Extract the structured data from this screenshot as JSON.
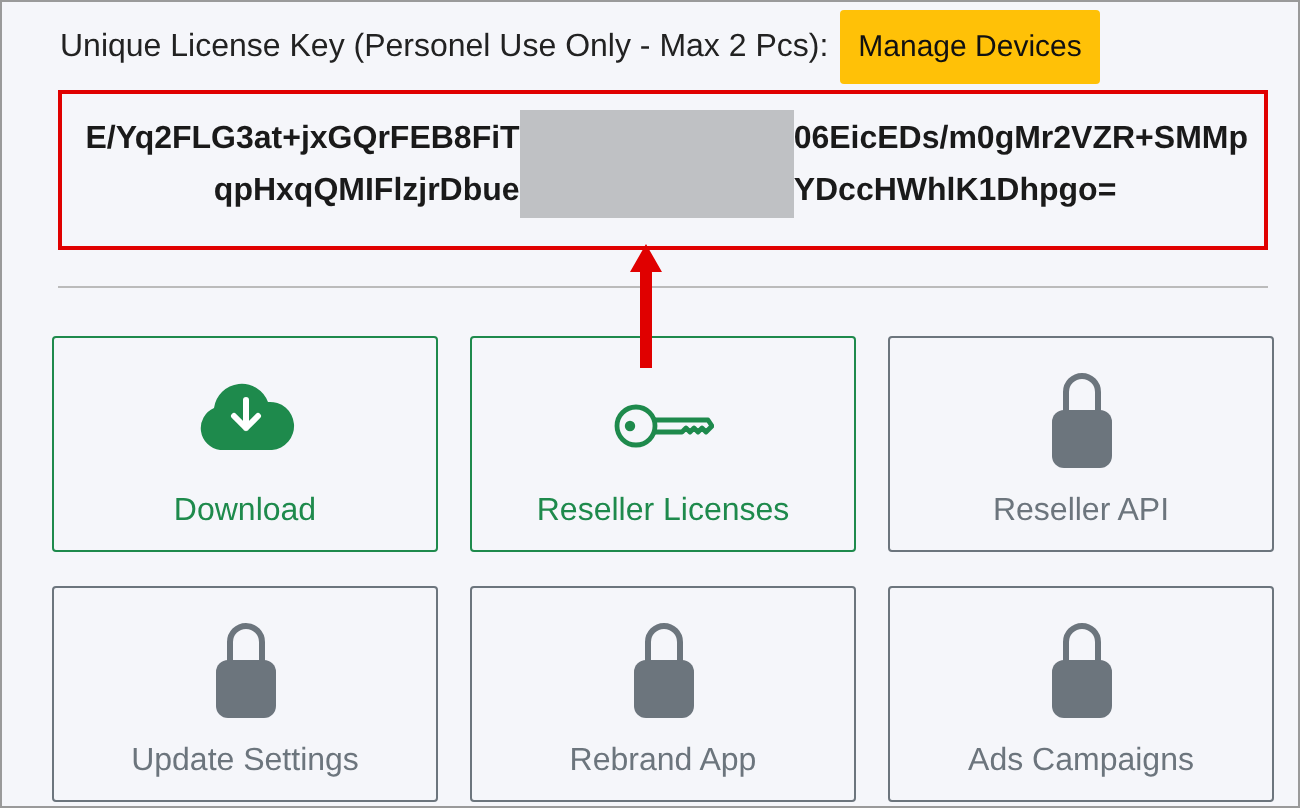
{
  "header": {
    "label": "Unique License Key (Personel Use Only - Max 2 Pcs):",
    "button": "Manage Devices"
  },
  "license_key": {
    "redacted": true,
    "lines": [
      {
        "before": "E/Yq2FLG3at+jxGQrFEB8FiT",
        "after": "06EicEDs/m0gMr2VZR+SMMp"
      },
      {
        "before": "qpHxqQMIFlzjrDbue",
        "after": "YDccHWhlK1Dhpgo="
      }
    ]
  },
  "tiles": [
    {
      "label": "Download",
      "kind": "download",
      "locked": false
    },
    {
      "label": "Reseller Licenses",
      "kind": "key",
      "locked": false
    },
    {
      "label": "Reseller API",
      "kind": "lock",
      "locked": true
    },
    {
      "label": "Update Settings",
      "kind": "lock",
      "locked": true
    },
    {
      "label": "Rebrand App",
      "kind": "lock",
      "locked": true
    },
    {
      "label": "Ads Campaigns",
      "kind": "lock",
      "locked": true
    }
  ]
}
